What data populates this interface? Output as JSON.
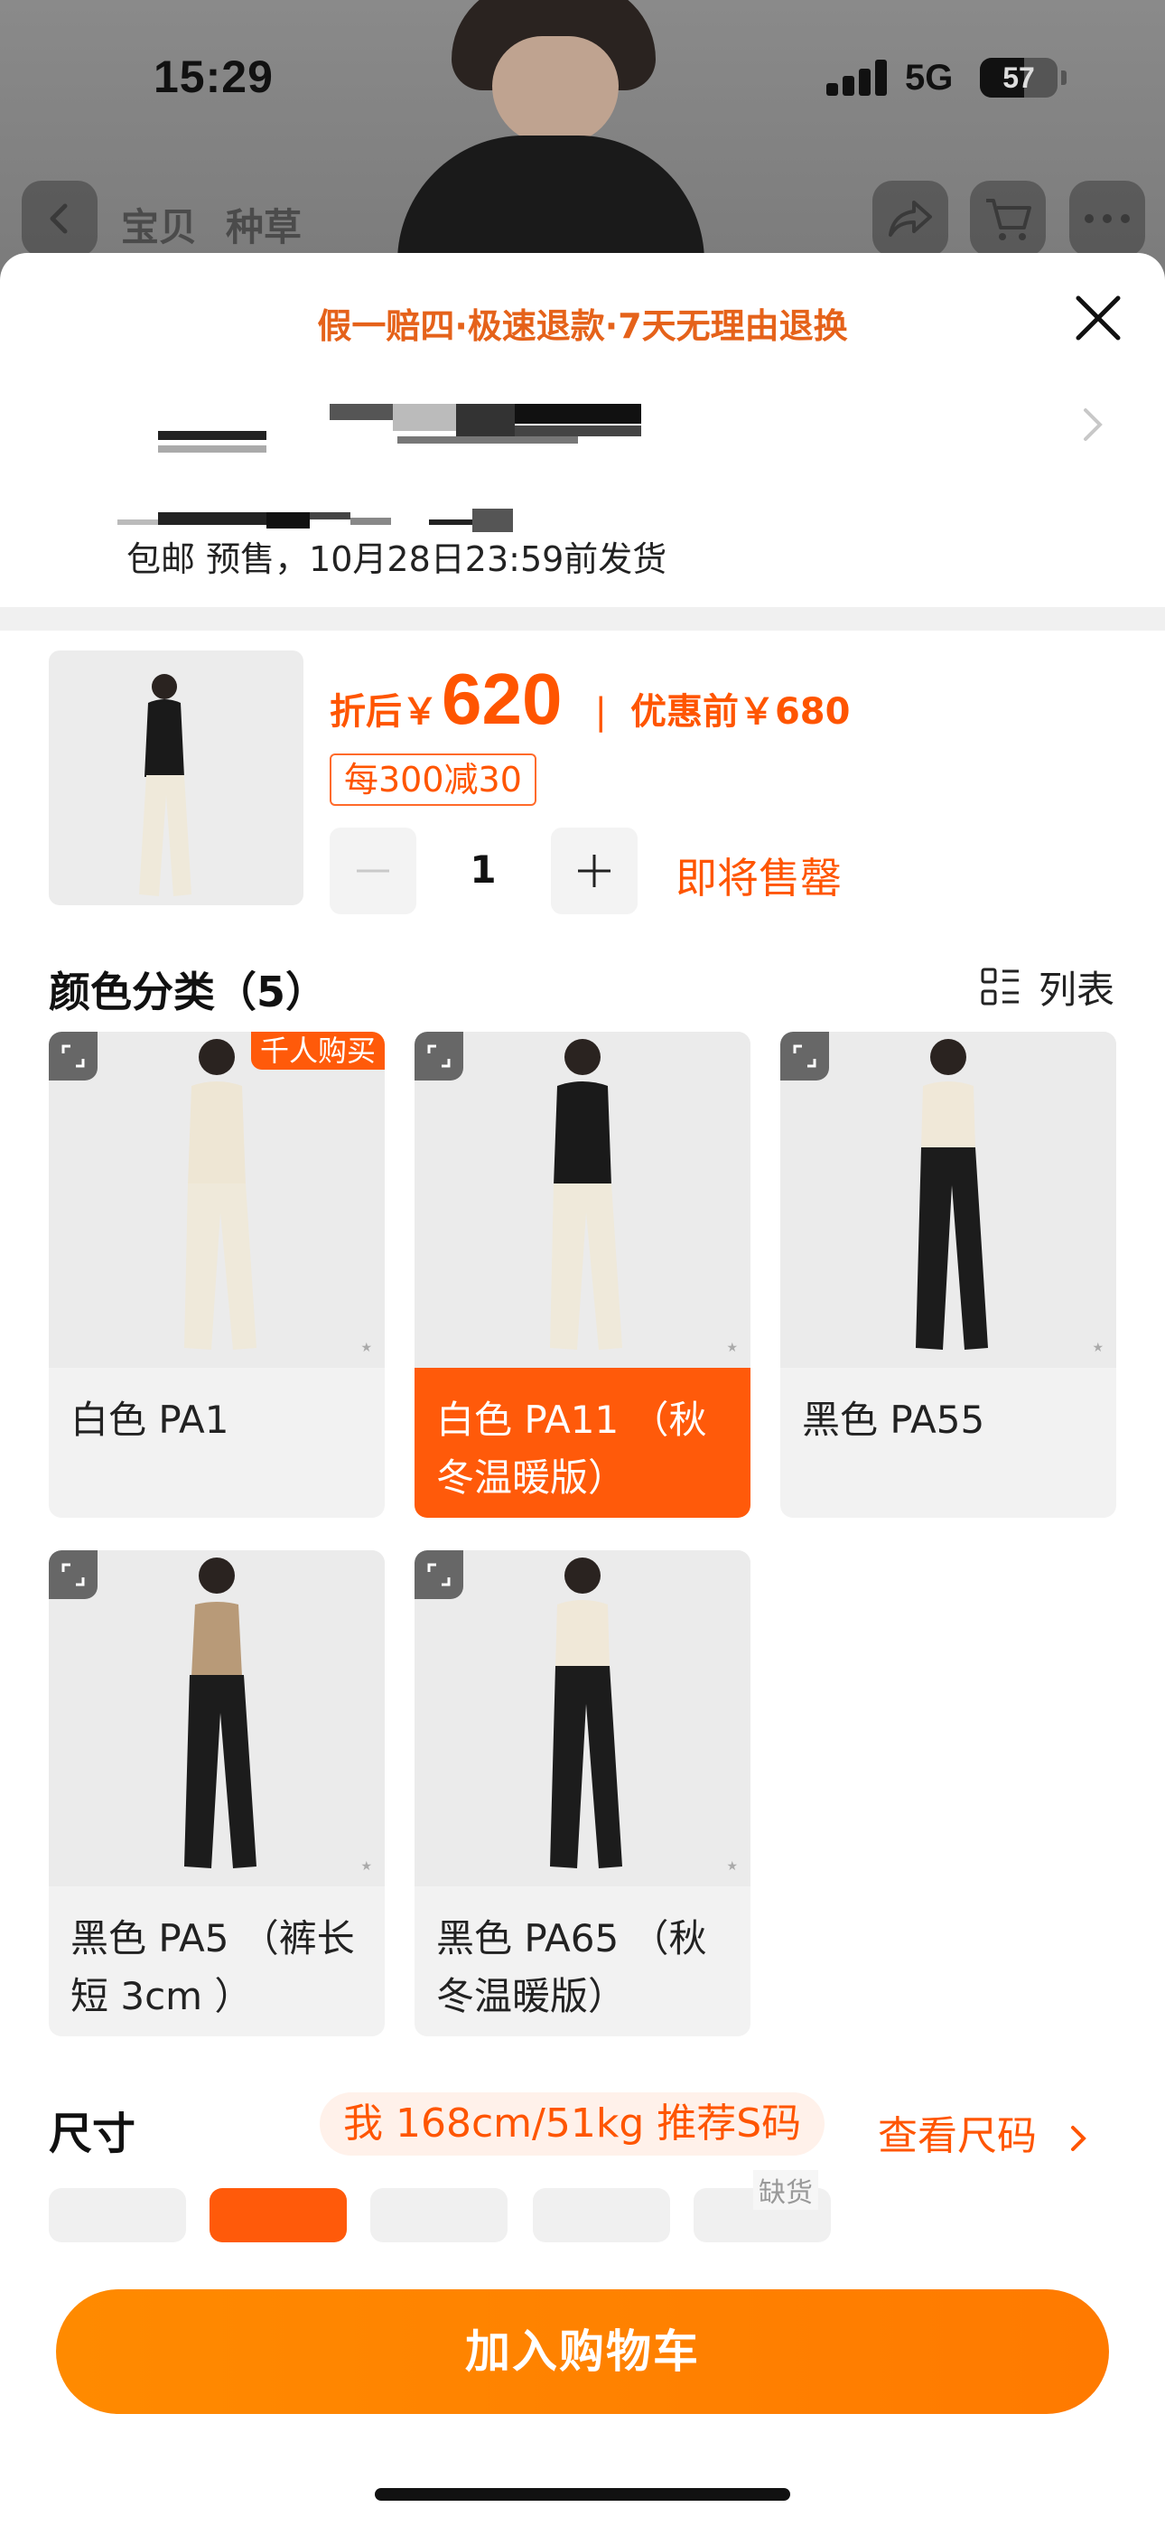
{
  "status_bar": {
    "time": "15:29",
    "network": "5G",
    "battery": "57",
    "battery_level": 0.57
  },
  "nav": {
    "tabs": [
      "宝贝",
      "种草"
    ],
    "cart_badge": ""
  },
  "sheet": {
    "guarantee": "假一赔四·极速退款·7天无理由退换",
    "shipping": "包邮 预售，10月28日23:59前发货"
  },
  "product": {
    "price_prefix": "折后￥",
    "price": "620",
    "price_separator": "|",
    "original_price_label": "优惠前￥680",
    "coupon": "每300减30",
    "quantity": "1",
    "stock_note": "即将售罄"
  },
  "color_section": {
    "title": "颜色分类（5）",
    "list_toggle": "列表",
    "options": [
      {
        "label": "白色 PA1",
        "badge": "千人购买",
        "selected": false
      },
      {
        "label": "白色 PA11 （秋冬温暖版）",
        "badge": "",
        "selected": true
      },
      {
        "label": "黑色 PA55",
        "badge": "",
        "selected": false
      },
      {
        "label": "黑色 PA5 （裤长短 3cm ）",
        "badge": "",
        "selected": false
      },
      {
        "label": "黑色 PA65 （秋冬温暖版）",
        "badge": "",
        "selected": false
      }
    ]
  },
  "size_section": {
    "title": "尺寸",
    "recommendation": "我 168cm/51kg 推荐S码",
    "size_guide": "查看尺码",
    "sold_out_tag": "缺货"
  },
  "cta": {
    "add_to_cart": "加入购物车"
  },
  "colors": {
    "accent": "#ff5500",
    "cta": "#ff8000",
    "selected_bg": "#ff5a0a"
  }
}
